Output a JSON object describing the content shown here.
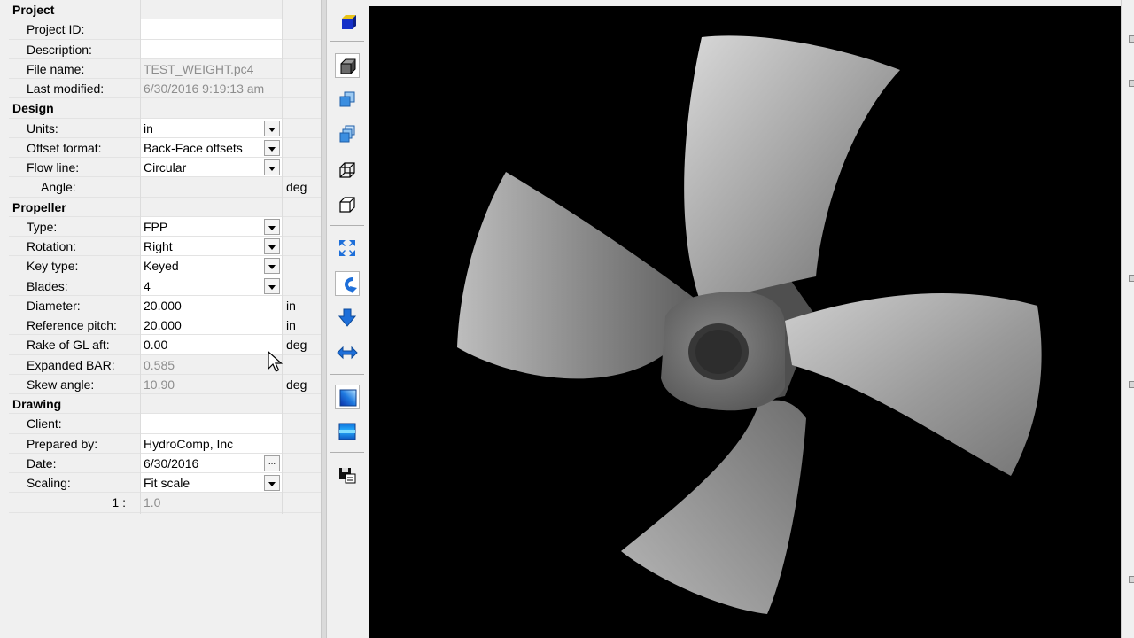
{
  "grid": {
    "rows": [
      {
        "kind": "cat",
        "label": "Project"
      },
      {
        "kind": "prop",
        "label": "Project ID:",
        "value": "",
        "field": "white"
      },
      {
        "kind": "prop",
        "label": "Description:",
        "value": "",
        "field": "white"
      },
      {
        "kind": "prop",
        "label": "File name:",
        "value": "TEST_WEIGHT.pc4",
        "field": "readonly"
      },
      {
        "kind": "prop",
        "label": "Last modified:",
        "value": "6/30/2016 9:19:13 am",
        "field": "readonly"
      },
      {
        "kind": "cat",
        "label": "Design"
      },
      {
        "kind": "prop",
        "label": "Units:",
        "value": "in",
        "field": "white",
        "control": "dropdown"
      },
      {
        "kind": "prop",
        "label": "Offset format:",
        "value": "Back-Face offsets",
        "field": "white",
        "control": "dropdown"
      },
      {
        "kind": "prop",
        "label": "Flow line:",
        "value": "Circular",
        "field": "white",
        "control": "dropdown"
      },
      {
        "kind": "prop",
        "label": "Angle:",
        "value": "",
        "field": "grey",
        "unit": "deg",
        "indent": "sub"
      },
      {
        "kind": "cat",
        "label": "Propeller"
      },
      {
        "kind": "prop",
        "label": "Type:",
        "value": "FPP",
        "field": "white",
        "control": "dropdown"
      },
      {
        "kind": "prop",
        "label": "Rotation:",
        "value": "Right",
        "field": "white",
        "control": "dropdown"
      },
      {
        "kind": "prop",
        "label": "Key type:",
        "value": "Keyed",
        "field": "white",
        "control": "dropdown"
      },
      {
        "kind": "prop",
        "label": "Blades:",
        "value": "4",
        "field": "white",
        "control": "dropdown"
      },
      {
        "kind": "prop",
        "label": "Diameter:",
        "value": "20.000",
        "field": "white",
        "unit": "in"
      },
      {
        "kind": "prop",
        "label": "Reference pitch:",
        "value": "20.000",
        "field": "white",
        "unit": "in"
      },
      {
        "kind": "prop",
        "label": "Rake of GL aft:",
        "value": "0.00",
        "field": "white",
        "unit": "deg"
      },
      {
        "kind": "prop",
        "label": "Expanded BAR:",
        "value": "0.585",
        "field": "readonly"
      },
      {
        "kind": "prop",
        "label": "Skew angle:",
        "value": "10.90",
        "field": "readonly",
        "unit": "deg"
      },
      {
        "kind": "cat",
        "label": "Drawing"
      },
      {
        "kind": "prop",
        "label": "Client:",
        "value": "",
        "field": "white"
      },
      {
        "kind": "prop",
        "label": "Prepared by:",
        "value": "HydroComp, Inc",
        "field": "white"
      },
      {
        "kind": "prop",
        "label": "Date:",
        "value": "6/30/2016",
        "field": "white",
        "control": "ellipsis"
      },
      {
        "kind": "prop",
        "label": "Scaling:",
        "value": "Fit scale",
        "field": "white",
        "control": "dropdown"
      },
      {
        "kind": "prop",
        "label": "1 :",
        "value": "1.0",
        "field": "readonly",
        "indent": "right"
      }
    ],
    "ellipsis_glyph": "..."
  },
  "toolbar": {
    "buttons": [
      {
        "name": "cube-solid-blue-icon",
        "active": false
      },
      {
        "name": "solid-view-icon",
        "active": true
      },
      {
        "name": "multi-view-icon",
        "active": false
      },
      {
        "name": "layered-view-icon",
        "active": false
      },
      {
        "name": "wireframe-view-icon",
        "active": false
      },
      {
        "name": "outline-view-icon",
        "active": false
      },
      {
        "name": "zoom-extents-icon",
        "active": false
      },
      {
        "name": "rotate-icon",
        "active": true
      },
      {
        "name": "pan-down-icon",
        "active": false
      },
      {
        "name": "pan-horizontal-icon",
        "active": false
      },
      {
        "name": "gradient-shading-icon",
        "active": true
      },
      {
        "name": "flat-shading-icon",
        "active": false
      },
      {
        "name": "save-image-icon",
        "active": false
      }
    ]
  },
  "viewport": {
    "background": "#000000",
    "blade_count": 4
  },
  "colors": {
    "panel": "#f0f0f0",
    "field": "#ffffff",
    "readonly_text": "#8d8d8d",
    "accent_blue": "#1e6fd9"
  }
}
